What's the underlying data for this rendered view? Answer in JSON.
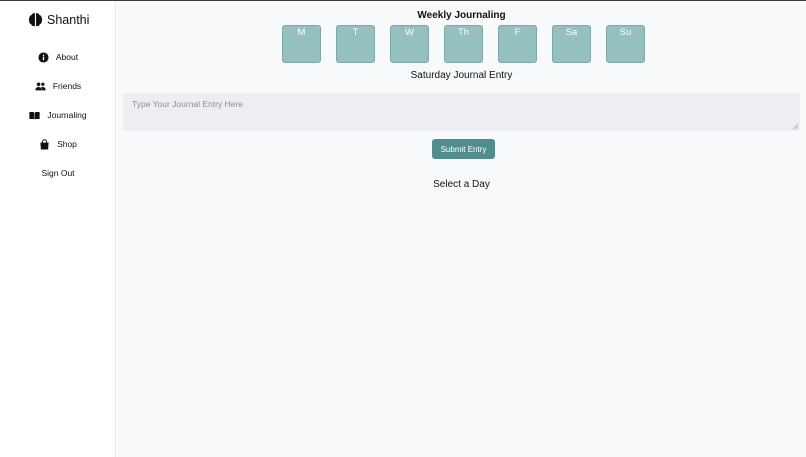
{
  "app": {
    "name": "Shanthi"
  },
  "sidebar": {
    "items": [
      {
        "label": "About",
        "icon": "info-icon"
      },
      {
        "label": "Friends",
        "icon": "users-icon"
      },
      {
        "label": "Journaling",
        "icon": "book-icon"
      },
      {
        "label": "Shop",
        "icon": "shopping-bag-icon"
      },
      {
        "label": "Sign Out",
        "icon": ""
      }
    ]
  },
  "main": {
    "weekly_title": "Weekly Journaling",
    "days": [
      "M",
      "T",
      "W",
      "Th",
      "F",
      "Sa",
      "Su"
    ],
    "entry_title": "Saturday Journal Entry",
    "entry_placeholder": "Type Your Journal Entry Here",
    "entry_value": "",
    "submit_label": "Submit Entry",
    "select_day_text": "Select a Day"
  },
  "colors": {
    "accent": "#4f8e8d",
    "day_tile": "#94c0bf",
    "main_bg": "#f8f9fb",
    "input_bg": "#eceef3"
  }
}
